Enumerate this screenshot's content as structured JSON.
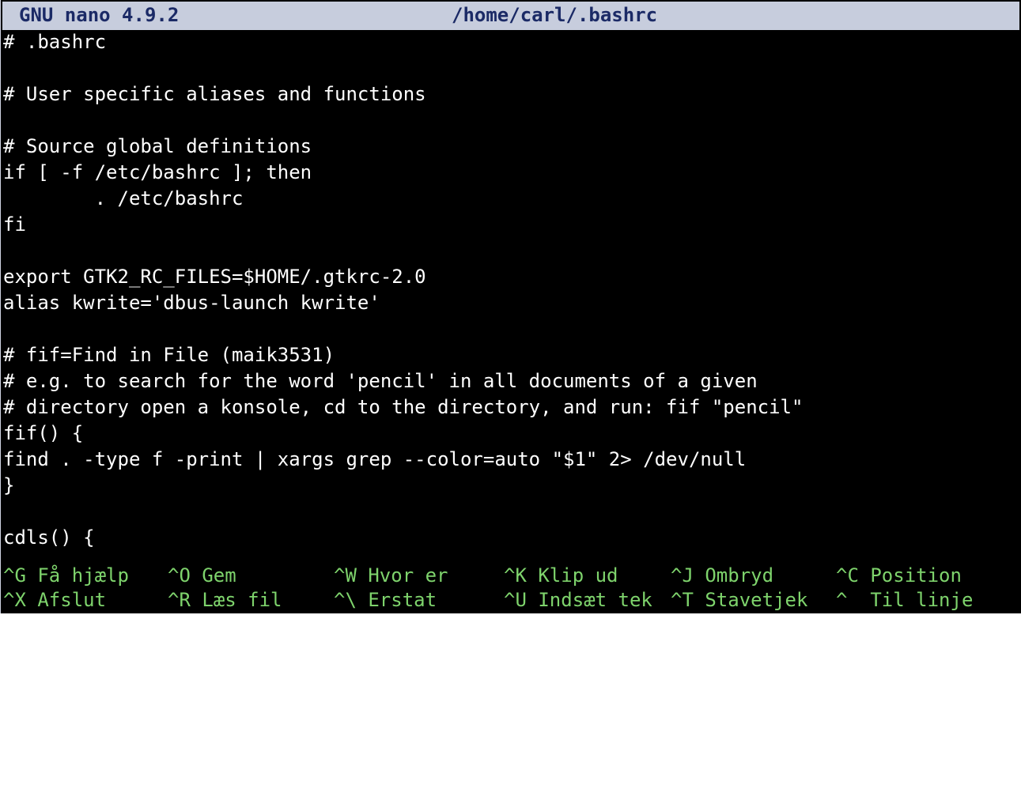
{
  "titlebar": {
    "app": "GNU nano 4.9.2",
    "filename": "/home/carl/.bashrc"
  },
  "editor": {
    "lines": [
      "# .bashrc",
      "",
      "# User specific aliases and functions",
      "",
      "# Source global definitions",
      "if [ -f /etc/bashrc ]; then",
      "        . /etc/bashrc",
      "fi",
      "",
      "export GTK2_RC_FILES=$HOME/.gtkrc-2.0",
      "alias kwrite='dbus-launch kwrite'",
      "",
      "# fif=Find in File (maik3531)",
      "# e.g. to search for the word 'pencil' in all documents of a given",
      "# directory open a konsole, cd to the directory, and run: fif \"pencil\"",
      "fif() {",
      "find . -type f -print | xargs grep --color=auto \"$1\" 2> /dev/null",
      "}",
      "",
      "cdls() {"
    ]
  },
  "help": {
    "row1": [
      "^G Få hjælp",
      "^O Gem",
      "^W Hvor er",
      "^K Klip ud",
      "^J Ombryd",
      "^C Position"
    ],
    "row2": [
      "^X Afslut",
      "^R Læs fil",
      "^\\ Erstat",
      "^U Indsæt tek",
      "^T Stavetjek",
      "^  Til linje"
    ]
  },
  "colors": {
    "background": "#000000",
    "text": "#ffffff",
    "titlebar_bg": "#c7cddd",
    "titlebar_text": "#1b2a66",
    "shortcut_text": "#7ed36c"
  }
}
